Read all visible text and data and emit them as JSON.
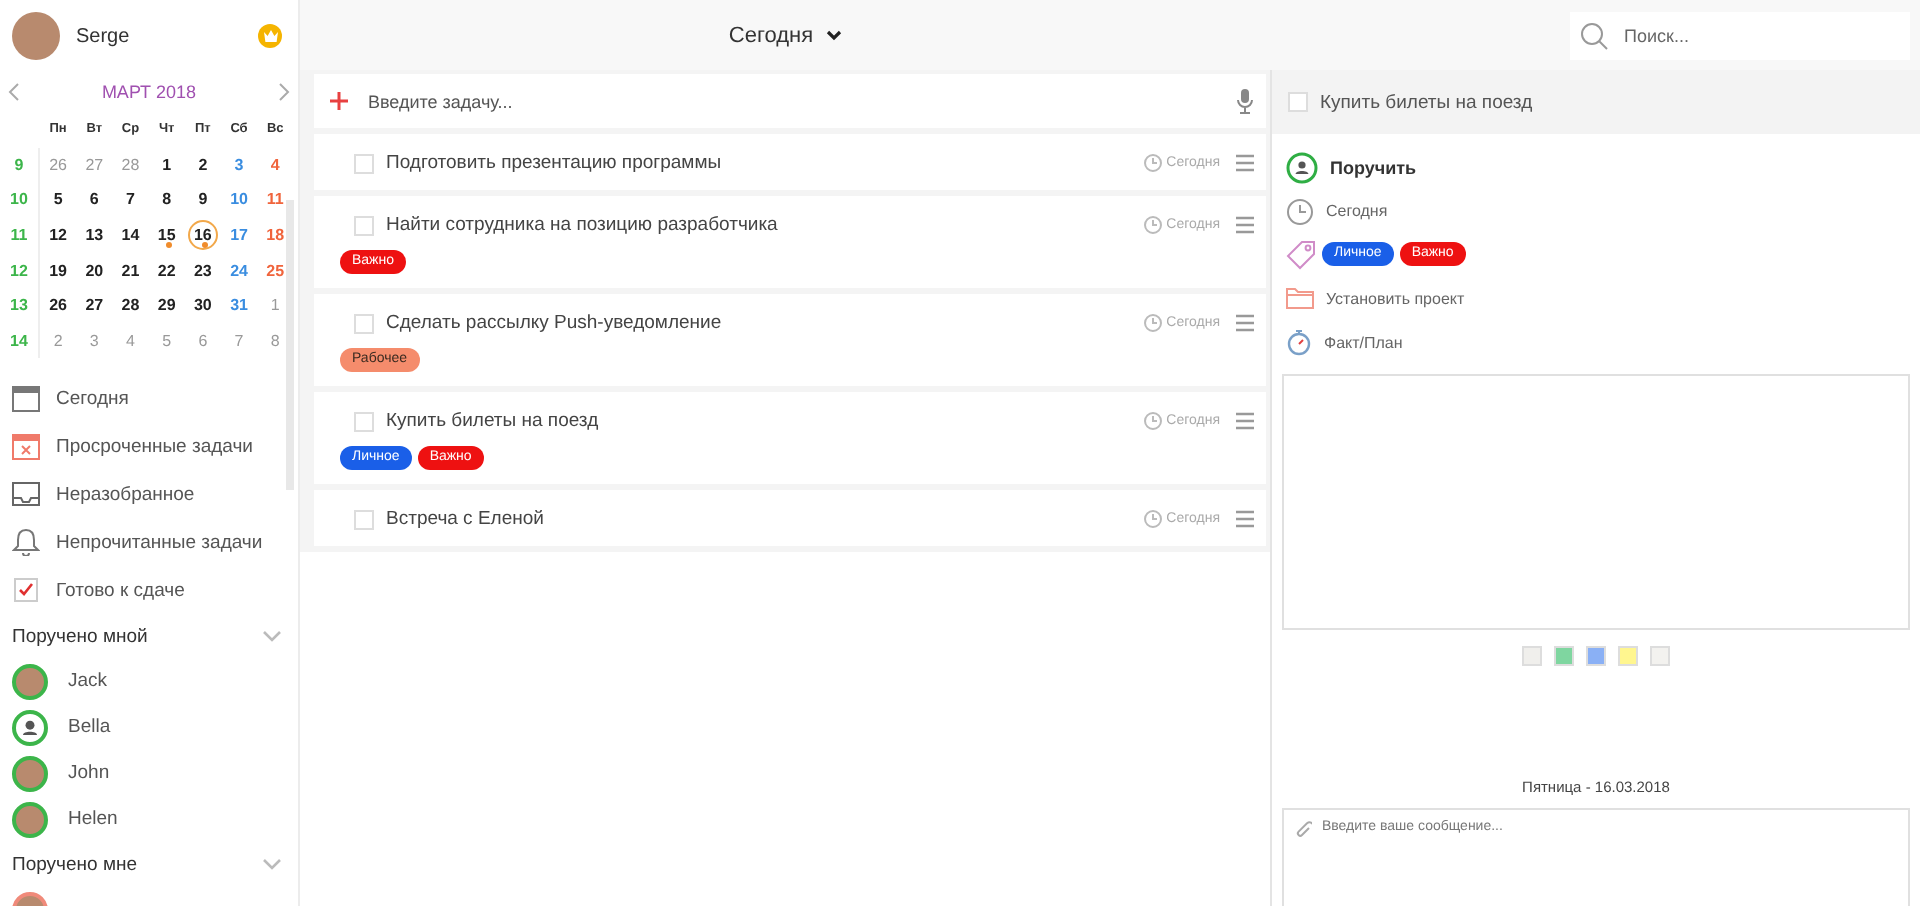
{
  "user": {
    "name": "Serge"
  },
  "calendar": {
    "month": "МАРТ 2018",
    "weekdays": [
      "Пн",
      "Вт",
      "Ср",
      "Чт",
      "Пт",
      "Сб",
      "Вс"
    ],
    "weeks": [
      {
        "number": "9",
        "days": [
          {
            "label": "26",
            "kind": "other",
            "selected": false,
            "has_task": false
          },
          {
            "label": "27",
            "kind": "other",
            "selected": false,
            "has_task": false
          },
          {
            "label": "28",
            "kind": "other",
            "selected": false,
            "has_task": false
          },
          {
            "label": "1",
            "kind": "day",
            "selected": false,
            "has_task": false
          },
          {
            "label": "2",
            "kind": "day",
            "selected": false,
            "has_task": false
          },
          {
            "label": "3",
            "kind": "sat",
            "selected": false,
            "has_task": false
          },
          {
            "label": "4",
            "kind": "sun",
            "selected": false,
            "has_task": false
          }
        ]
      },
      {
        "number": "10",
        "days": [
          {
            "label": "5",
            "kind": "day",
            "selected": false,
            "has_task": false
          },
          {
            "label": "6",
            "kind": "day",
            "selected": false,
            "has_task": false
          },
          {
            "label": "7",
            "kind": "day",
            "selected": false,
            "has_task": false
          },
          {
            "label": "8",
            "kind": "day",
            "selected": false,
            "has_task": false
          },
          {
            "label": "9",
            "kind": "day",
            "selected": false,
            "has_task": false
          },
          {
            "label": "10",
            "kind": "sat",
            "selected": false,
            "has_task": false
          },
          {
            "label": "11",
            "kind": "sun",
            "selected": false,
            "has_task": false
          }
        ]
      },
      {
        "number": "11",
        "days": [
          {
            "label": "12",
            "kind": "day",
            "selected": false,
            "has_task": false
          },
          {
            "label": "13",
            "kind": "day",
            "selected": false,
            "has_task": false
          },
          {
            "label": "14",
            "kind": "day",
            "selected": false,
            "has_task": false
          },
          {
            "label": "15",
            "kind": "day",
            "selected": false,
            "has_task": true
          },
          {
            "label": "16",
            "kind": "day",
            "selected": true,
            "has_task": true
          },
          {
            "label": "17",
            "kind": "sat",
            "selected": false,
            "has_task": false
          },
          {
            "label": "18",
            "kind": "sun",
            "selected": false,
            "has_task": false
          }
        ]
      },
      {
        "number": "12",
        "days": [
          {
            "label": "19",
            "kind": "day",
            "selected": false,
            "has_task": false
          },
          {
            "label": "20",
            "kind": "day",
            "selected": false,
            "has_task": false
          },
          {
            "label": "21",
            "kind": "day",
            "selected": false,
            "has_task": false
          },
          {
            "label": "22",
            "kind": "day",
            "selected": false,
            "has_task": false
          },
          {
            "label": "23",
            "kind": "day",
            "selected": false,
            "has_task": false
          },
          {
            "label": "24",
            "kind": "sat",
            "selected": false,
            "has_task": false
          },
          {
            "label": "25",
            "kind": "sun",
            "selected": false,
            "has_task": false
          }
        ]
      },
      {
        "number": "13",
        "days": [
          {
            "label": "26",
            "kind": "day",
            "selected": false,
            "has_task": false
          },
          {
            "label": "27",
            "kind": "day",
            "selected": false,
            "has_task": false
          },
          {
            "label": "28",
            "kind": "day",
            "selected": false,
            "has_task": false
          },
          {
            "label": "29",
            "kind": "day",
            "selected": false,
            "has_task": false
          },
          {
            "label": "30",
            "kind": "day",
            "selected": false,
            "has_task": false
          },
          {
            "label": "31",
            "kind": "sat",
            "selected": false,
            "has_task": false
          },
          {
            "label": "1",
            "kind": "other",
            "selected": false,
            "has_task": false
          }
        ]
      },
      {
        "number": "14",
        "days": [
          {
            "label": "2",
            "kind": "other",
            "selected": false,
            "has_task": false
          },
          {
            "label": "3",
            "kind": "other",
            "selected": false,
            "has_task": false
          },
          {
            "label": "4",
            "kind": "other",
            "selected": false,
            "has_task": false
          },
          {
            "label": "5",
            "kind": "other",
            "selected": false,
            "has_task": false
          },
          {
            "label": "6",
            "kind": "other",
            "selected": false,
            "has_task": false
          },
          {
            "label": "7",
            "kind": "other",
            "selected": false,
            "has_task": false
          },
          {
            "label": "8",
            "kind": "other",
            "selected": false,
            "has_task": false
          }
        ]
      }
    ]
  },
  "nav": [
    {
      "kind": "today",
      "label": "Сегодня"
    },
    {
      "kind": "overdue",
      "label": "Просроченные задачи"
    },
    {
      "kind": "inbox",
      "label": "Неразобранное"
    },
    {
      "kind": "unread",
      "label": "Непрочитанные задачи"
    },
    {
      "kind": "done",
      "label": "Готово к сдаче"
    }
  ],
  "sections": [
    {
      "title": "Поручено мной",
      "people": [
        {
          "name": "Jack",
          "kind": "photo",
          "color": "#3cb54a"
        },
        {
          "name": "Bella",
          "kind": "silhouette",
          "color": "#3cb54a"
        },
        {
          "name": "John",
          "kind": "photo",
          "color": "#3cb54a"
        },
        {
          "name": "Helen",
          "kind": "photo",
          "color": "#3cb54a"
        }
      ]
    },
    {
      "title": "Поручено мне",
      "people": [
        {
          "kind": "photo",
          "color": "#f08a7a"
        }
      ]
    }
  ],
  "topbar": {
    "title": "Сегодня",
    "search": {
      "placeholder": "Поиск..."
    }
  },
  "task_input": {
    "placeholder": "Введите задачу..."
  },
  "tasks": [
    {
      "title": "Подготовить презентацию программы",
      "checked": false,
      "due": "Сегодня"
    },
    {
      "title": "Найти сотрудника на позицию разработчика",
      "checked": false,
      "due": "Сегодня",
      "tags": [
        {
          "label": "Важно",
          "color": "#ee1111"
        }
      ]
    },
    {
      "title": "Сделать рассылку Push-уведомление",
      "checked": false,
      "due": "Сегодня",
      "tags": [
        {
          "label": "Рабочее",
          "color": "#f58c6c"
        }
      ]
    },
    {
      "title": "Купить билеты на поезд",
      "checked": false,
      "due": "Сегодня",
      "tags": [
        {
          "label": "Личное",
          "color": "#1a5fe8"
        },
        {
          "label": "Важно",
          "color": "#ee1111"
        }
      ]
    },
    {
      "title": "Встреча с Еленой",
      "checked": false,
      "due": "Сегодня"
    }
  ],
  "detail": {
    "title": "Купить билеты на поезд",
    "checked": false,
    "rows": [
      {
        "kind": "assign",
        "label": "Поручить"
      },
      {
        "kind": "date",
        "label": "Сегодня"
      },
      {
        "kind": "tags",
        "tags": [
          {
            "label": "Личное",
            "color": "#1a5fe8"
          },
          {
            "label": "Важно",
            "color": "#ee1111"
          }
        ]
      },
      {
        "kind": "project",
        "label": "Установить проект"
      },
      {
        "kind": "timer",
        "label": "Факт/План"
      }
    ],
    "swatches": [
      {
        "color": "#f0efec"
      },
      {
        "color": "#7fd6a0"
      },
      {
        "color": "#8ab0f5"
      },
      {
        "color": "#fff68f"
      },
      {
        "color": "#f3f2ef"
      }
    ],
    "date": "Пятница - 16.03.2018",
    "message": {
      "placeholder": "Введите ваше сообщение..."
    }
  }
}
